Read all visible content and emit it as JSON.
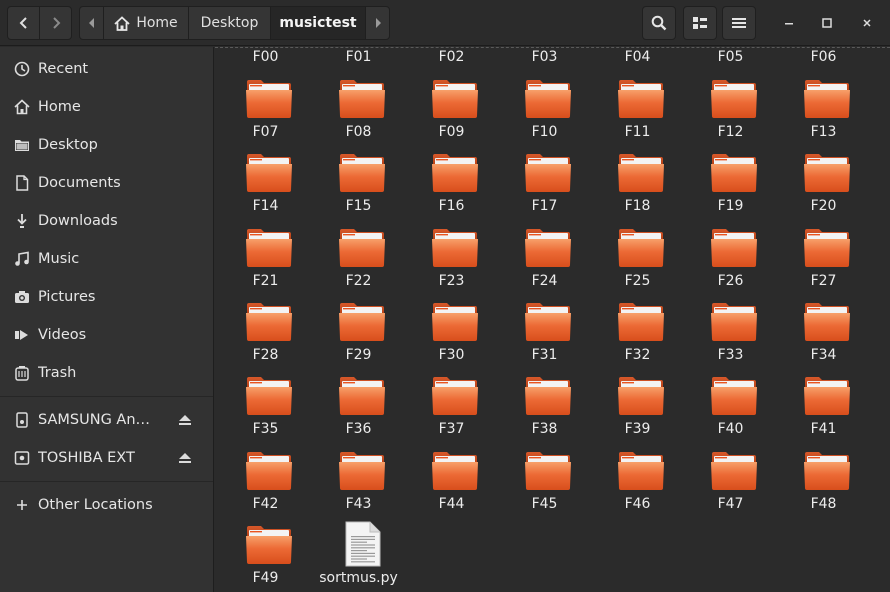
{
  "header": {
    "path": [
      "Home",
      "Desktop",
      "musictest"
    ],
    "window_controls": [
      "minimize",
      "maximize",
      "close"
    ]
  },
  "sidebar": {
    "places": [
      {
        "label": "Recent",
        "icon": "clock-icon"
      },
      {
        "label": "Home",
        "icon": "home-icon"
      },
      {
        "label": "Desktop",
        "icon": "folder-icon"
      },
      {
        "label": "Documents",
        "icon": "document-icon"
      },
      {
        "label": "Downloads",
        "icon": "download-icon"
      },
      {
        "label": "Music",
        "icon": "music-icon"
      },
      {
        "label": "Pictures",
        "icon": "camera-icon"
      },
      {
        "label": "Videos",
        "icon": "video-icon"
      },
      {
        "label": "Trash",
        "icon": "trash-icon"
      }
    ],
    "devices": [
      {
        "label": "SAMSUNG Andr...",
        "icon": "drive-icon"
      },
      {
        "label": "TOSHIBA EXT",
        "icon": "drive-icon"
      }
    ],
    "other_locations": "Other Locations"
  },
  "files": {
    "partial_row": [
      "F00",
      "F01",
      "F02",
      "F03",
      "F04",
      "F05",
      "F06"
    ],
    "items": [
      "F07",
      "F08",
      "F09",
      "F10",
      "F11",
      "F12",
      "F13",
      "F14",
      "F15",
      "F16",
      "F17",
      "F18",
      "F19",
      "F20",
      "F21",
      "F22",
      "F23",
      "F24",
      "F25",
      "F26",
      "F27",
      "F28",
      "F29",
      "F30",
      "F31",
      "F32",
      "F33",
      "F34",
      "F35",
      "F36",
      "F37",
      "F38",
      "F39",
      "F40",
      "F41",
      "F42",
      "F43",
      "F44",
      "F45",
      "F46",
      "F47",
      "F48",
      "F49"
    ],
    "script_file": "sortmus.py"
  },
  "colors": {
    "accent_folder": "#e95420",
    "background": "#2b2b2b",
    "sidebar": "#323232"
  }
}
